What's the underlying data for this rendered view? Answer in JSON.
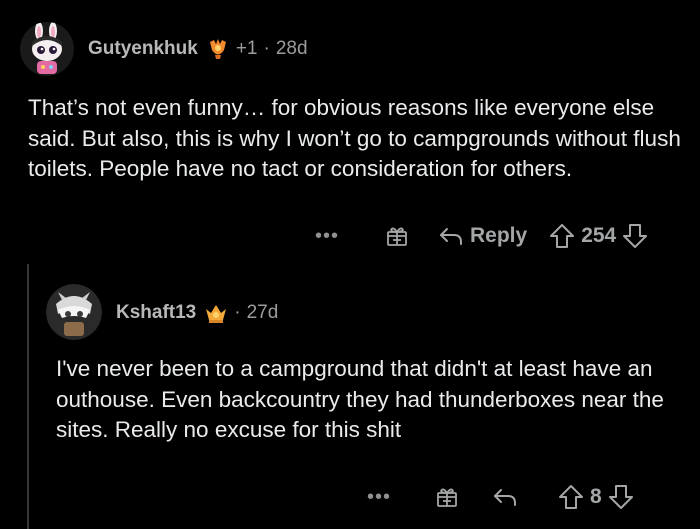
{
  "comments": [
    {
      "username": "Gutyenkhuk",
      "karma": "+1",
      "separator": "·",
      "time": "28d",
      "flair_icon": "trophy-flair-icon",
      "avatar": "snoo-avatar-bunny-ears",
      "body": "That’s not even funny… for obvious reasons like everyone else said. But also, this is why I won’t go to campgrounds without flush toilets. People have no tact or consideration for others.",
      "actions": {
        "more": "•••",
        "reply_label": "Reply",
        "score": "254"
      }
    },
    {
      "username": "Kshaft13",
      "separator": "·",
      "time": "27d",
      "flair_icon": "crown-flair-icon",
      "avatar": "snoo-avatar-helmet",
      "body": "I've never been to a campground that didn't at least have an outhouse. Even backcountry they had thunderboxes near the sites. Really no excuse for this shit",
      "actions": {
        "more": "•••",
        "score": "8"
      }
    }
  ],
  "colors": {
    "background": "#000000",
    "text": "#e9ebed",
    "meta": "#9a9c9e",
    "thread_line": "#343536"
  }
}
